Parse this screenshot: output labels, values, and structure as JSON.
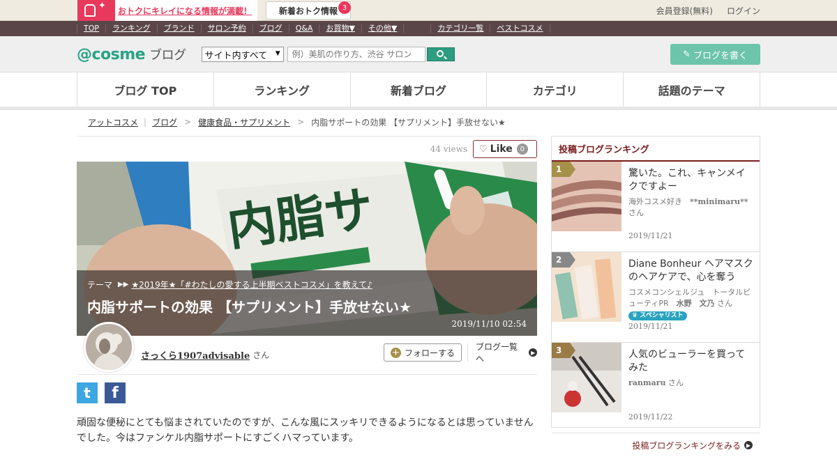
{
  "promo": {
    "text": "おトクにキレイになる情報が満載！",
    "new_info": "新着おトク情報",
    "new_count": "3"
  },
  "account": {
    "register": "会員登録(無料)",
    "login": "ログイン"
  },
  "darknav": {
    "items": [
      "TOP",
      "ランキング",
      "ブランド",
      "サロン予約",
      "ブログ",
      "Q&A",
      "お買物▼",
      "その他▼"
    ],
    "right_items": [
      "カテゴリ一覧",
      "ベストコスメ"
    ]
  },
  "header": {
    "logo": "@cosme",
    "logo_sub": "ブログ",
    "scope_select": "サイト内すべて",
    "search_placeholder": "例）美肌の作り方、渋谷 サロン",
    "write_button": "ブログを書く"
  },
  "mainnav": {
    "tabs": [
      "ブログ TOP",
      "ランキング",
      "新着ブログ",
      "カテゴリ",
      "話題のテーマ"
    ]
  },
  "breadcrumb": {
    "items": [
      "アットコスメ",
      "ブログ",
      "健康食品・サプリメント"
    ],
    "current": "内脂サポートの効果 【サプリメント】手放せない★"
  },
  "post": {
    "views": "44 views",
    "like_label": "Like",
    "like_count": "0",
    "theme_label": "テーマ",
    "theme_link": "★2019年★「#わたしの愛する上半期ベストコスメ」を教えて♪",
    "title": "内脂サポートの効果 【サプリメント】手放せない★",
    "date": "2019/11/10 02:54",
    "author_name": "さっくら1907advisable",
    "author_suffix": "さん",
    "follow_label": "フォローする",
    "blog_list_label": "ブログ一覧へ",
    "body": "頑固な便秘にとても悩まされていたのですが、こんな風にスッキリできるようになるとは思っていませんでした。今はファンケル内脂サポートにすごくハマっています。"
  },
  "ranking": {
    "heading": "投稿ブログランキング",
    "items": [
      {
        "rank": "1",
        "title": "驚いた。これ、キャンメイクですよー",
        "author_prefix": "海外コスメ好き　",
        "author": "**minimaru**",
        "suffix": "さん",
        "date": "2019/11/21"
      },
      {
        "rank": "2",
        "title": "Diane Bonheur ヘアマスクのヘアケアで、心を奪う美…",
        "author_prefix": "コスメコンシェルジュ　トータルビューティPR　",
        "author": "水野　文乃",
        "suffix": "さん",
        "badge": "スペシャリスト",
        "date": "2019/11/21"
      },
      {
        "rank": "3",
        "title": "人気のビューラーを買ってみた",
        "author_prefix": "",
        "author": "ranmaru",
        "suffix": "さん",
        "date": "2019/11/22"
      }
    ],
    "more": "投稿ブログランキングをみる"
  }
}
